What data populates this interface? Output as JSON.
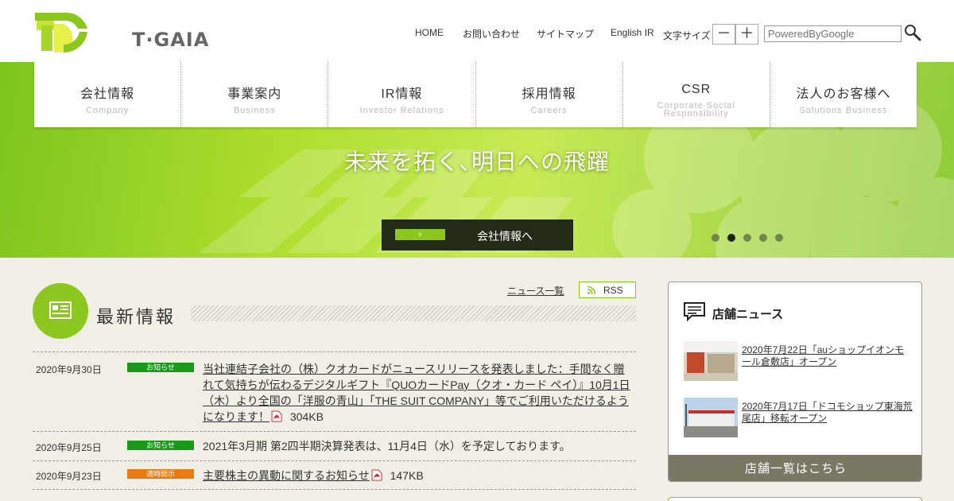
{
  "brand": {
    "name": "T·GAIA"
  },
  "header": {
    "util_links": [
      "HOME",
      "お問い合わせ",
      "サイトマップ",
      "English IR"
    ],
    "font_size_label": "文字サイズ",
    "font_minus": "－",
    "font_plus": "＋",
    "search_placeholder": "PoweredByGoogle"
  },
  "nav": [
    {
      "jp": "会社情報",
      "en": "Company"
    },
    {
      "jp": "事業案内",
      "en": "Business"
    },
    {
      "jp": "IR情報",
      "en": "Investor Relations"
    },
    {
      "jp": "採用情報",
      "en": "Careers"
    },
    {
      "jp": "CSR",
      "en": "Corporate Social Responsibility"
    },
    {
      "jp": "法人のお客様へ",
      "en": "Solutions Business"
    }
  ],
  "hero": {
    "title": "未来を拓く､明日への飛躍",
    "button_arrow": "›",
    "button_label": "会社情報へ",
    "slide_count": 5,
    "active_slide": 2
  },
  "news": {
    "title": "最新情報",
    "list_link": "ニュース一覧",
    "rss_label": "RSS",
    "items": [
      {
        "date": "2020年9月30日",
        "badge": "お知らせ",
        "badge_color": "green",
        "text": "当社連結子会社の（株）クオカードがニュースリリースを発表しました：手間なく贈れて気持ちが伝わるデジタルギフト『QUOカードPay（クオ・カード ペイ）』10月1日（木）より全国の「洋服の青山」「THE SUIT COMPANY」等でご利用いただけるようになります！",
        "size": "304KB"
      },
      {
        "date": "2020年9月25日",
        "badge": "お知らせ",
        "badge_color": "green",
        "text": "2021年3月期 第2四半期決算発表は、11月4日（水）を予定しております。",
        "size": ""
      },
      {
        "date": "2020年9月23日",
        "badge": "適時開示",
        "badge_color": "orange",
        "text": "主要株主の異動に関するお知らせ",
        "size": "147KB"
      }
    ]
  },
  "shop_news": {
    "title": "店舗ニュース",
    "items": [
      {
        "text": "2020年7月22日「auショップイオンモール倉敷店」オープン"
      },
      {
        "text": "2020年7月17日「ドコモショップ東海荒尾店」移転オープン"
      }
    ],
    "all_link": "店舗一覧はこちら"
  },
  "colors": {
    "brand_green": "#8bc71f",
    "badge_green": "#1a9a1a",
    "badge_orange": "#ea7a12",
    "shop_footer": "#7a7764"
  }
}
